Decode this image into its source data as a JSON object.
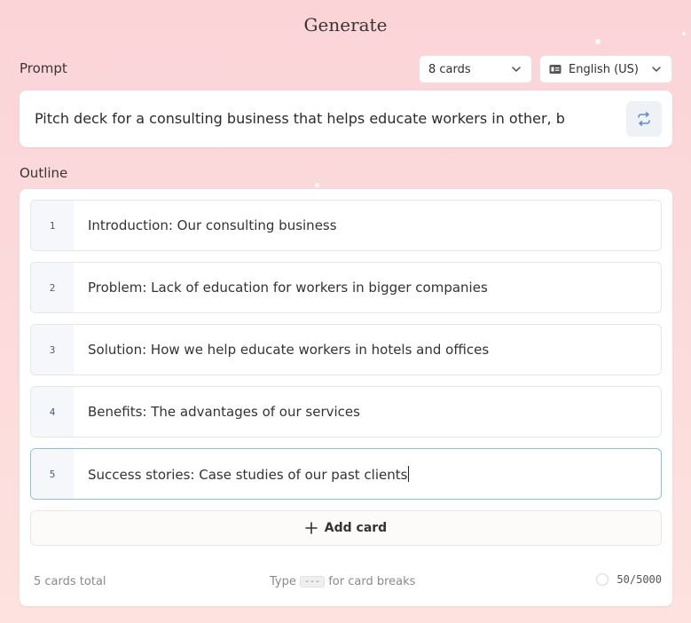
{
  "header": {
    "title": "Generate"
  },
  "prompt": {
    "label": "Prompt",
    "card_count_select": "8 cards",
    "language_select": "English (US)",
    "text": "Pitch deck for a consulting business that helps educate workers in other, b"
  },
  "outline": {
    "label": "Outline",
    "cards": [
      {
        "num": "1",
        "text": "Introduction: Our consulting business"
      },
      {
        "num": "2",
        "text": "Problem: Lack of education for workers in bigger companies"
      },
      {
        "num": "3",
        "text": "Solution: How we help educate workers in hotels and offices"
      },
      {
        "num": "4",
        "text": "Benefits: The advantages of our services"
      },
      {
        "num": "5",
        "text": "Success stories: Case studies of our past clients"
      }
    ],
    "add_card_label": "Add card",
    "footer": {
      "total": "5 cards total",
      "hint_prefix": "Type",
      "hint_kbd": "---",
      "hint_suffix": "for card breaks",
      "char_count": "50/5000"
    }
  }
}
